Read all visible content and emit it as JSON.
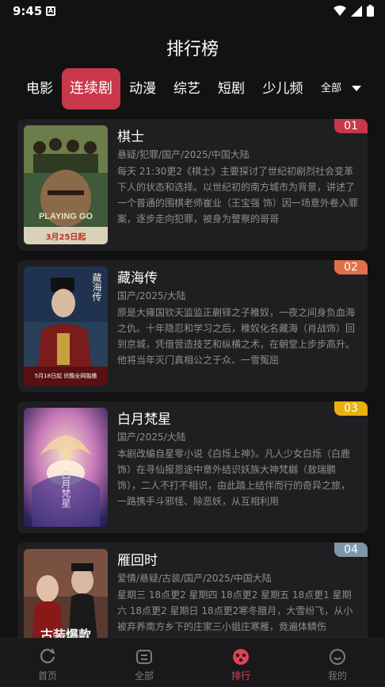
{
  "status": {
    "time": "9:45",
    "app_icon_letter": "A"
  },
  "page_title": "排行榜",
  "tabs": [
    {
      "label": "电影"
    },
    {
      "label": "连续剧",
      "active": true
    },
    {
      "label": "动漫"
    },
    {
      "label": "综艺"
    },
    {
      "label": "短剧"
    },
    {
      "label": "少儿频"
    }
  ],
  "tab_all_label": "全部",
  "items": [
    {
      "rank": "01",
      "rank_color": "#c8384a",
      "name": "棋士",
      "meta": "悬疑/犯罪/国产/2025/中国大陆",
      "desc": "每天 21:30更2《棋士》主要探讨了世纪初剧烈社会变革下人的状态和选择。以世纪初的南方城市为背景，讲述了一个普通的围棋老师崔业（王宝强 饰）因一场意外卷入罪案，逐步走向犯罪，被身为警察的哥哥",
      "poster_text": "PLAYING GO",
      "poster_date": "3月25日起",
      "poster_vertical": ""
    },
    {
      "rank": "02",
      "rank_color": "#e0704a",
      "name": "藏海传",
      "meta": "国产/2025/大陆",
      "desc": "原是大雍国钦天监监正蒯铎之子稚奴，一夜之间身负血海之仇。十年隐忍和学习之后，稚奴化名藏海（肖战饰）回到京城，凭借营造技艺和纵横之术，在朝堂上步步高升。他将当年灭门真相公之于众、一雪冤屈",
      "poster_text": "",
      "poster_date": "5月18日起 优酷全网独播",
      "poster_vertical": "藏海传"
    },
    {
      "rank": "03",
      "rank_color": "#e8b010",
      "name": "白月梵星",
      "meta": "国产/2025/大陆",
      "desc": "本剧改编自星零小说《白烁上神》。凡人少女白烁（白鹿饰）在寻仙报恩途中意外结识妖族大神梵樾（敖瑞鹏饰），二人不打不相识，由此踏上结伴而行的奇异之旅，一路携手斗邪怪、除恶妖，从互相利用",
      "poster_text": "",
      "poster_date": "",
      "poster_vertical": "白月梵星"
    },
    {
      "rank": "04",
      "rank_color": "#7d96aa",
      "name": "雁回时",
      "meta": "爱情/悬疑/古装/国产/2025/中国大陆",
      "desc": "星期三 18点更2 星期四 18点更2 星期五 18点更1 星期六 18点更2 星期日 18点更2寒冬腊月，大雪纷飞，从小被弃养南方乡下的庄家三小姐庄寒雁，竟遍体鳞伤",
      "poster_text": "古装爆款",
      "poster_date": "",
      "poster_vertical": ""
    }
  ],
  "bottom_nav": [
    {
      "label": "首页",
      "icon": "home-icon"
    },
    {
      "label": "全部",
      "icon": "all-icon"
    },
    {
      "label": "排行",
      "icon": "rank-icon",
      "active": true
    },
    {
      "label": "我的",
      "icon": "profile-icon"
    }
  ],
  "colors": {
    "accent": "#c8384a",
    "active_nav": "#e0405a",
    "card_bg": "#1f1f21",
    "bg": "#121212"
  }
}
